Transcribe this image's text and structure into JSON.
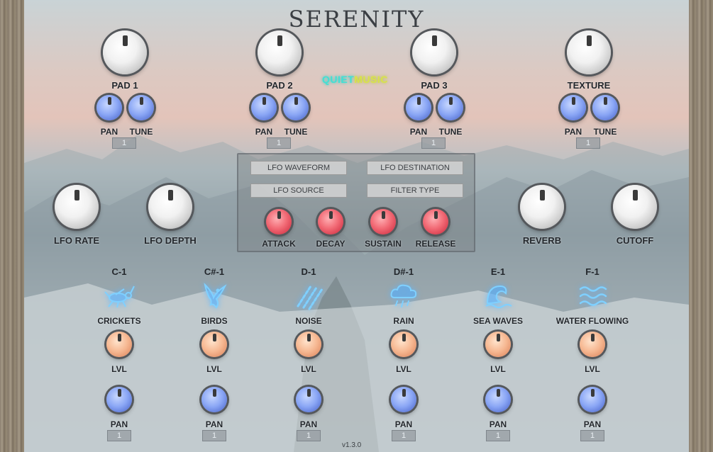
{
  "app": {
    "title": "SERENITY",
    "brand_part1": "QUIET",
    "brand_part2": "MUSIC",
    "version": "v1.3.0"
  },
  "pads": [
    {
      "label": "PAD 1",
      "pan": "PAN",
      "tune": "TUNE",
      "value": "1"
    },
    {
      "label": "PAD 2",
      "pan": "PAN",
      "tune": "TUNE",
      "value": "1"
    },
    {
      "label": "PAD 3",
      "pan": "PAN",
      "tune": "TUNE",
      "value": "1"
    },
    {
      "label": "TEXTURE",
      "pan": "PAN",
      "tune": "TUNE",
      "value": "1"
    }
  ],
  "lfo": {
    "rate": "LFO RATE",
    "depth": "LFO DEPTH",
    "waveform": "LFO WAVEFORM",
    "destination": "LFO DESTINATION",
    "source": "LFO SOURCE",
    "filter_type": "FILTER TYPE"
  },
  "envelope": {
    "attack": "ATTACK",
    "decay": "DECAY",
    "sustain": "SUSTAIN",
    "release": "RELEASE"
  },
  "fx": {
    "reverb": "REVERB",
    "cutoff": "CUTOFF"
  },
  "samples": [
    {
      "note": "C-1",
      "name": "CRICKETS",
      "icon": "cricket-icon",
      "lvl": "LVL",
      "pan": "PAN",
      "value": "1"
    },
    {
      "note": "C#-1",
      "name": "BIRDS",
      "icon": "bird-icon",
      "lvl": "LVL",
      "pan": "PAN",
      "value": "1"
    },
    {
      "note": "D-1",
      "name": "NOISE",
      "icon": "noise-icon",
      "lvl": "LVL",
      "pan": "PAN",
      "value": "1"
    },
    {
      "note": "D#-1",
      "name": "RAIN",
      "icon": "rain-cloud-icon",
      "lvl": "LVL",
      "pan": "PAN",
      "value": "1"
    },
    {
      "note": "E-1",
      "name": "SEA WAVES",
      "icon": "wave-icon",
      "lvl": "LVL",
      "pan": "PAN",
      "value": "1"
    },
    {
      "note": "F-1",
      "name": "WATER FLOWING",
      "icon": "water-flowing-icon",
      "lvl": "LVL",
      "pan": "PAN",
      "value": "1"
    }
  ],
  "colors": {
    "accent_blue": "#8aa6f5",
    "accent_red": "#f26b76",
    "accent_peach": "#f6b892",
    "icon_glow": "#5bb6ff"
  }
}
